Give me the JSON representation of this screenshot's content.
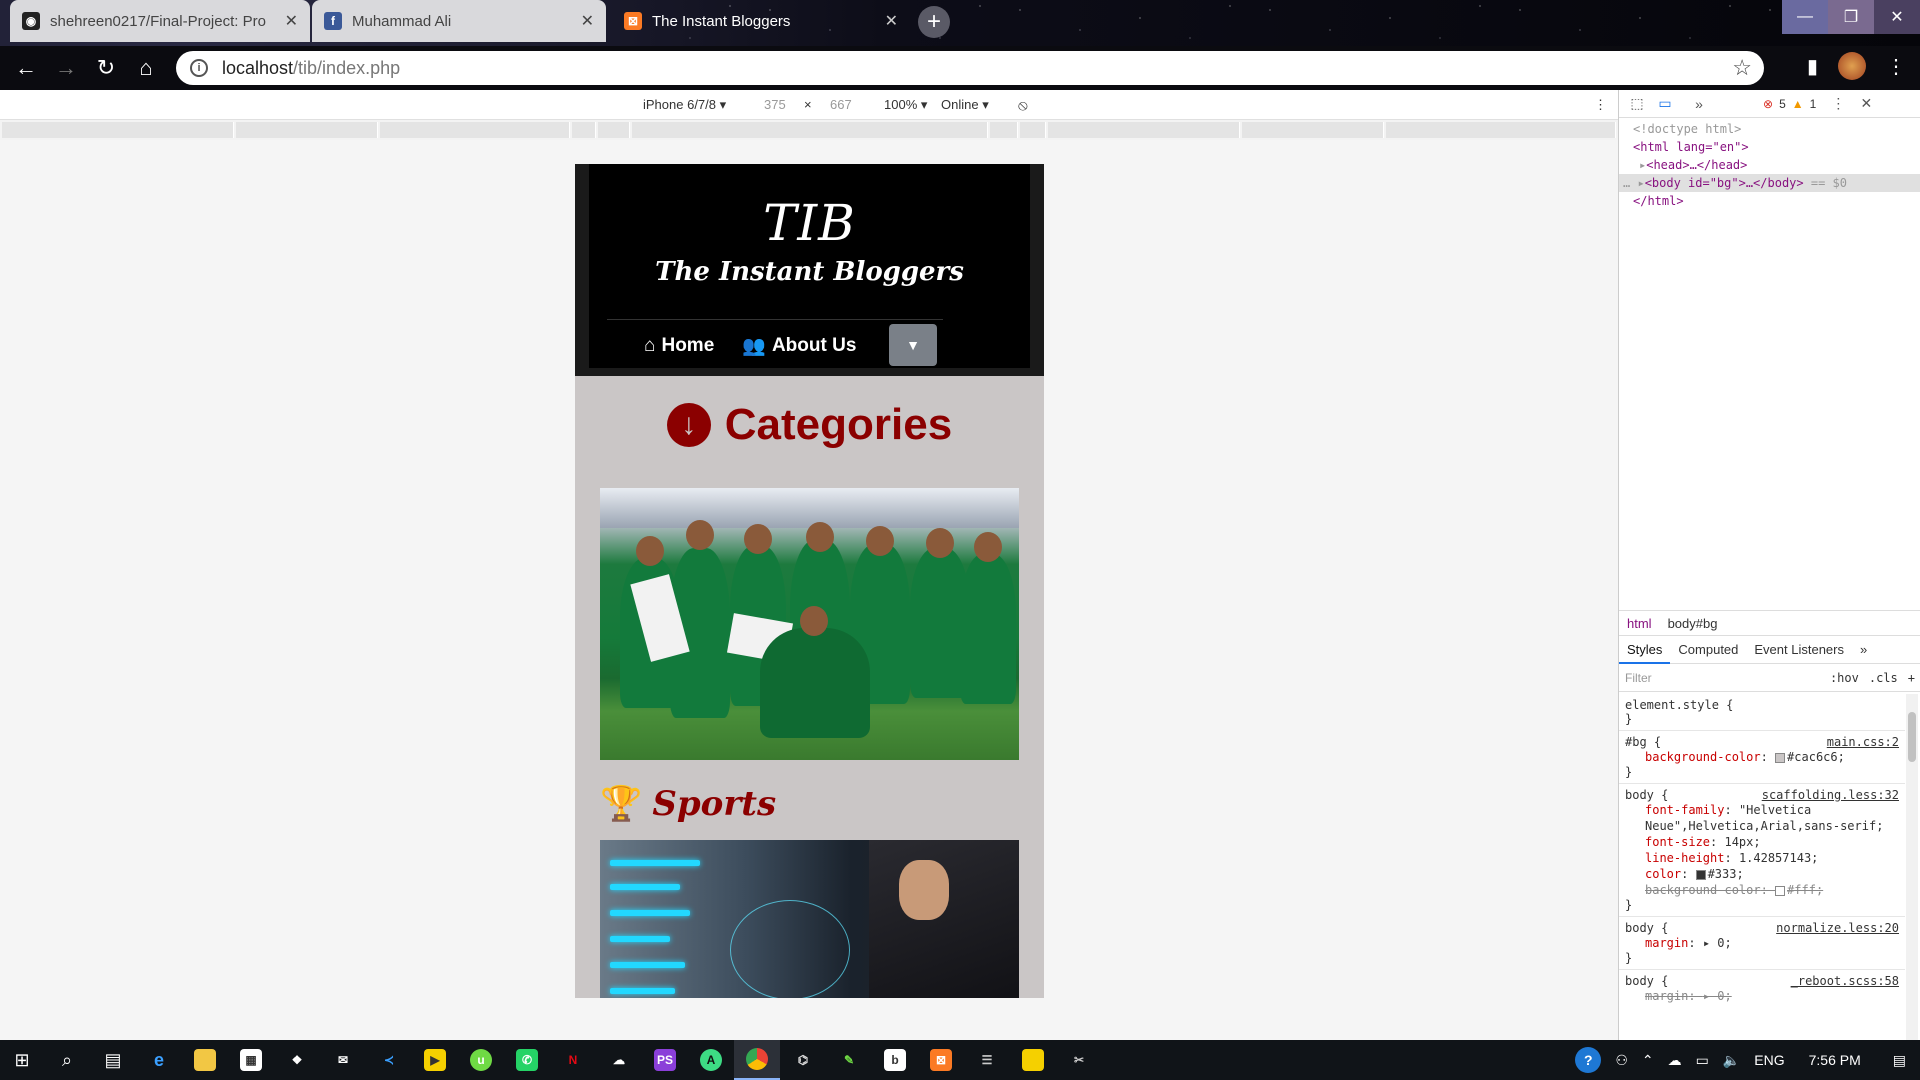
{
  "browser": {
    "tabs": [
      {
        "title": "shehreen0217/Final-Project: Pro",
        "icon": "github-icon",
        "active": false
      },
      {
        "title": "Muhammad Ali",
        "icon": "facebook-icon",
        "active": false
      },
      {
        "title": "The Instant Bloggers",
        "icon": "xampp-icon",
        "active": true
      }
    ],
    "address": {
      "host": "localhost",
      "path": "/tib/index.php"
    }
  },
  "device_toolbar": {
    "device": "iPhone 6/7/8",
    "width": "375",
    "times": "×",
    "height": "667",
    "zoom": "100%",
    "network": "Online"
  },
  "site": {
    "logo_main": "TIB",
    "logo_sub": "The Instant Bloggers",
    "nav": [
      {
        "label": "Home",
        "icon": "home-icon"
      },
      {
        "label": "About Us",
        "icon": "users-icon"
      }
    ],
    "categories_title": "Categories",
    "section_title": "Sports"
  },
  "devtools": {
    "errors": "5",
    "warnings": "1",
    "dom": {
      "doctype": "<!doctype html>",
      "html_open": "<html lang=\"en\">",
      "head": "<head>…</head>",
      "body": "<body id=\"bg\">…</body>",
      "body_suffix": "== $0",
      "html_close": "</html>"
    },
    "breadcrumbs": [
      "html",
      "body#bg"
    ],
    "subtabs": [
      "Styles",
      "Computed",
      "Event Listeners"
    ],
    "filter_placeholder": "Filter",
    "filter_opts": [
      ":hov",
      ".cls",
      "+"
    ],
    "rules": [
      {
        "selector": "element.style {",
        "source": "",
        "props": [],
        "close": "}"
      },
      {
        "selector": "#bg {",
        "source": "main.css:2",
        "props": [
          {
            "name": "background-color",
            "value": "#cac6c6;",
            "swatch": "#cac6c6",
            "struck": false
          }
        ],
        "close": "}"
      },
      {
        "selector": "body {",
        "source": "scaffolding.less:32",
        "props": [
          {
            "name": "font-family",
            "value": "\"Helvetica Neue\",Helvetica,Arial,sans-serif;",
            "struck": false
          },
          {
            "name": "font-size",
            "value": "14px;",
            "struck": false
          },
          {
            "name": "line-height",
            "value": "1.42857143;",
            "struck": false
          },
          {
            "name": "color",
            "value": "#333;",
            "swatch": "#333333",
            "struck": false
          },
          {
            "name": "background-color",
            "value": "#fff;",
            "swatch": "#ffffff",
            "struck": true
          }
        ],
        "close": "}"
      },
      {
        "selector": "body {",
        "source": "normalize.less:20",
        "props": [
          {
            "name": "margin",
            "value": "▸ 0;",
            "struck": false
          }
        ],
        "close": "}"
      },
      {
        "selector": "body {",
        "source": "_reboot.scss:58",
        "props": [
          {
            "name": "margin",
            "value": "▸ 0;",
            "struck": true
          }
        ],
        "close": ""
      }
    ]
  },
  "taskbar": {
    "lang": "ENG",
    "time": "7:56 PM"
  },
  "colors": {
    "page_bg": "#cac6c6",
    "accent": "#8b0000",
    "header_bg": "#000000"
  }
}
